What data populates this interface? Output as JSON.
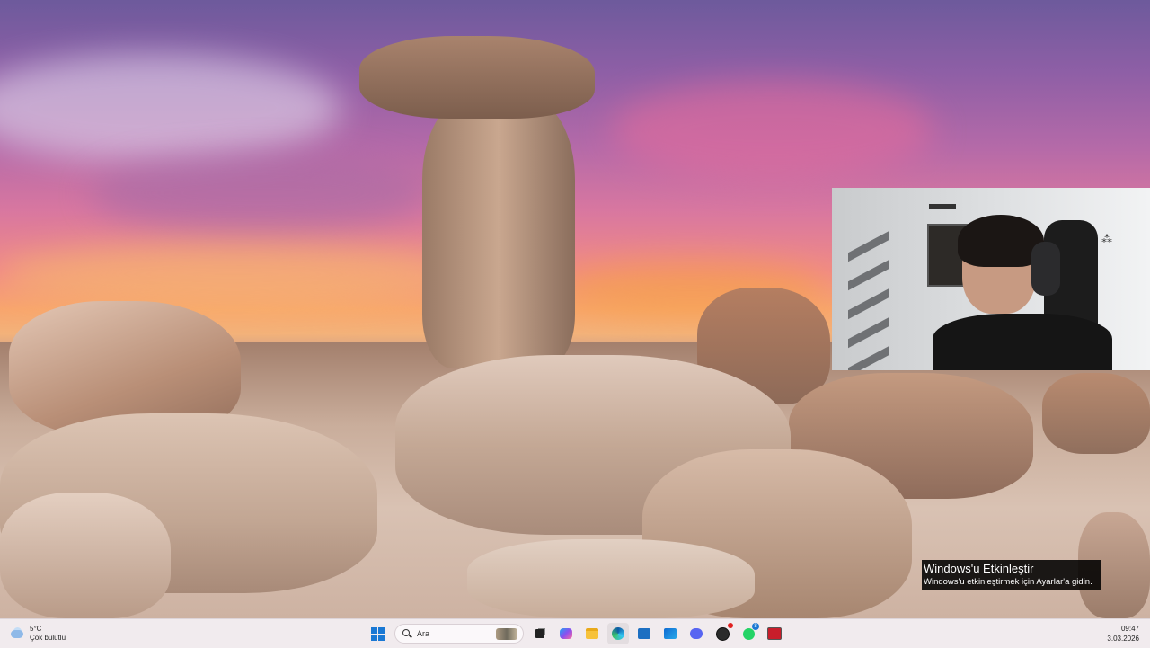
{
  "desktop": {
    "wallpaper": "desert hoodoo rock formations at sunset"
  },
  "activation": {
    "title": "Windows'u Etkinleştir",
    "subtitle": "Windows'u etkinleştirmek için Ayarlar'a gidin."
  },
  "taskbar": {
    "weather": {
      "temperature": "5°C",
      "condition": "Çok bulutlu",
      "icon": "cloud-icon"
    },
    "search": {
      "placeholder": "Ara"
    },
    "apps": [
      {
        "name": "start",
        "icon": "windows-logo-icon"
      },
      {
        "name": "task-view",
        "icon": "task-view-icon"
      },
      {
        "name": "copilot",
        "icon": "copilot-icon"
      },
      {
        "name": "file-explorer",
        "icon": "folder-icon"
      },
      {
        "name": "edge",
        "icon": "edge-icon"
      },
      {
        "name": "store",
        "icon": "store-icon"
      },
      {
        "name": "outlook",
        "icon": "outlook-icon"
      },
      {
        "name": "discord",
        "icon": "discord-icon"
      },
      {
        "name": "obs",
        "icon": "obs-icon"
      },
      {
        "name": "whatsapp",
        "icon": "whatsapp-icon",
        "badge": "8"
      },
      {
        "name": "voicemeeter",
        "icon": "voicemeeter-icon"
      }
    ],
    "clock": {
      "time": "09:47",
      "date": "3.03.2026"
    }
  },
  "colors": {
    "taskbar_bg": "#f1ebee",
    "accent": "#1a78d4"
  }
}
